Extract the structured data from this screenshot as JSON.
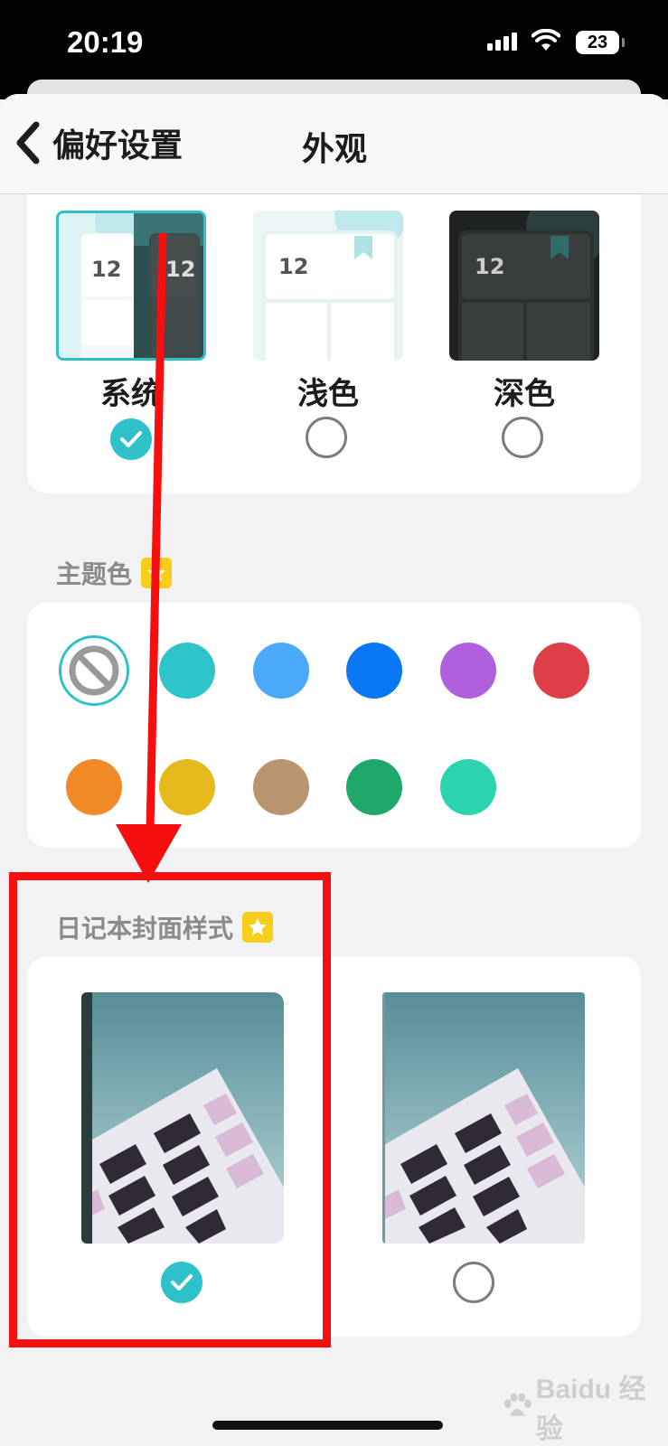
{
  "status_bar": {
    "time": "20:19",
    "battery": "23"
  },
  "nav": {
    "back_label": "偏好设置",
    "title": "外观"
  },
  "appearance": {
    "preview_day": "12",
    "options": [
      {
        "label": "系统",
        "selected": true
      },
      {
        "label": "浅色",
        "selected": false
      },
      {
        "label": "深色",
        "selected": false
      }
    ]
  },
  "theme_color": {
    "title": "主题色",
    "swatches": [
      "none",
      "#2fc4cb",
      "#4aa9f8",
      "#0a77f5",
      "#b060dc",
      "#de3e45",
      "#f08a26",
      "#e6ba1c",
      "#b89570",
      "#1fa86b",
      "#2bd3ae"
    ]
  },
  "cover_style": {
    "title": "日记本封面样式",
    "options": [
      {
        "selected": true
      },
      {
        "selected": false
      }
    ]
  },
  "watermark": "Baidu 经验",
  "colors": {
    "accent": "#2ec1c9",
    "annotation": "#f50f0f"
  }
}
